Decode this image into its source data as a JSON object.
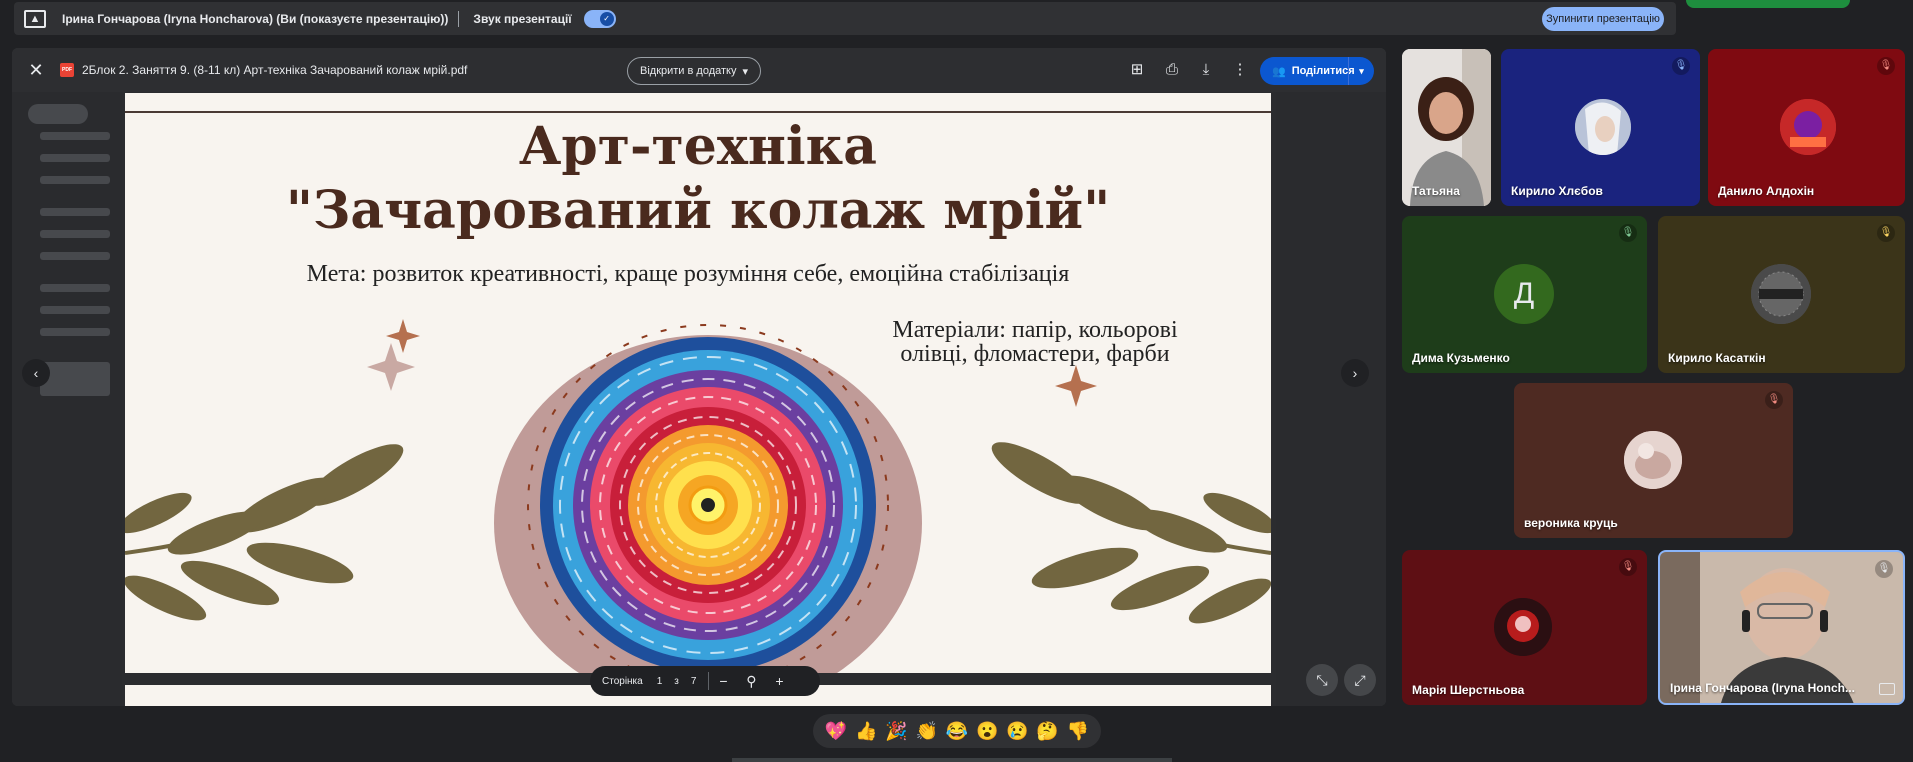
{
  "presentation_bar": {
    "presenter_text": "Ірина Гончарова (Iryna Honcharova) (Ви (показуєте презентацію))",
    "sound_label": "Звук презентації",
    "stop_button": "Зупинити презентацію"
  },
  "viewer": {
    "file_title": "2Блок 2. Заняття 9. (8-11 кл) Арт-техніка Зачарований колаж мрій.pdf",
    "pdf_badge": "PDF",
    "open_with": "Відкрити в додатку",
    "share": "Поділитися",
    "pager": {
      "label": "Сторінка",
      "current": "1",
      "of": "з",
      "total": "7"
    }
  },
  "slide": {
    "title_line1": "Арт-техніка",
    "title_line2": "\"Зачарований колаж мрій\"",
    "goal": "Мета: розвиток креативності, краще розуміння себе, емоційна стабілізація",
    "materials_line1": "Матеріали: папір, кольорові",
    "materials_line2": "олівці, фломастери, фарби"
  },
  "participants": [
    {
      "name": "Татьяна",
      "color": "#d9d4d2"
    },
    {
      "name": "Кирило Хлєбов",
      "color": "#1a237e"
    },
    {
      "name": "Данило Алдохін",
      "color": "#7f0a11"
    },
    {
      "name": "Дима Кузьменко",
      "color": "#1e3d1a",
      "initial": "Д"
    },
    {
      "name": "Кирило Касаткін",
      "color": "#3b3419"
    },
    {
      "name": "вероника круць",
      "color": "#4e2a22"
    },
    {
      "name": "Марія Шерстньова",
      "color": "#5e0f14"
    },
    {
      "name": "Ірина Гончарова (Iryna Honch...",
      "color": "#b8a99c"
    }
  ],
  "reactions": [
    "💖",
    "👍",
    "🎉",
    "👏",
    "😂",
    "😮",
    "😢",
    "🤔",
    "👎"
  ],
  "colors": {
    "accent": "#8ab4f8",
    "share": "#0b57d0",
    "background": "#202124"
  }
}
